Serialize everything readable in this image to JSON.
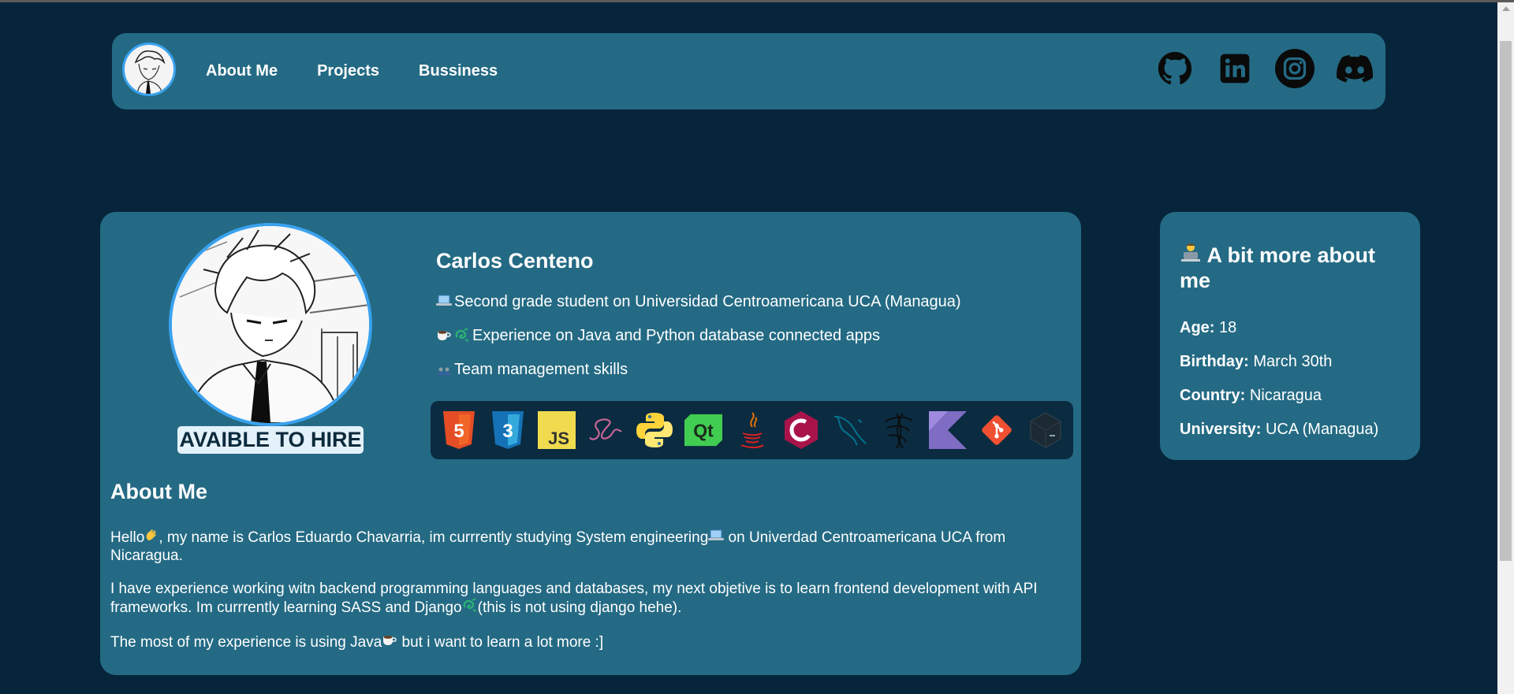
{
  "nav": {
    "links": [
      "About Me",
      "Projects",
      "Bussiness"
    ],
    "socials": [
      "github-icon",
      "linkedin-icon",
      "instagram-icon",
      "discord-icon"
    ]
  },
  "profile": {
    "name": "Carlos Centeno",
    "badge": "AVAIBLE TO HIRE",
    "lines": [
      {
        "icons": [
          "laptop-icon"
        ],
        "text": "Second grade student on Universidad Centroamericana UCA (Managua)"
      },
      {
        "icons": [
          "coffee-icon",
          "django-icon"
        ],
        "text": "Experience on Java and Python database connected apps"
      },
      {
        "icons": [
          "people-icon"
        ],
        "text": "Team management skills"
      }
    ],
    "tech": [
      "html5-icon",
      "css3-icon",
      "javascript-icon",
      "sass-icon",
      "python-icon",
      "qt-icon",
      "java-icon",
      "c-icon",
      "mysql-icon",
      "mssql-icon",
      "kotlin-icon",
      "git-icon",
      "terminal-icon"
    ]
  },
  "about": {
    "title": "About Me",
    "p1a": "Hello",
    "p1b": ", my name is Carlos Eduardo Chavarria, im currrently studying System engineering",
    "p1c": " on Univerdad Centroamericana UCA from Nicaragua.",
    "p2a": "I have experience working witn backend programming languages and databases, my next objetive is to learn frontend development with API frameworks. Im currrently learning SASS and Django",
    "p2b": "(this is not using django hehe).",
    "p3a": "The most of my experience is using Java",
    "p3b": " but i want to learn a lot more :]"
  },
  "side": {
    "title": "A bit more about me",
    "age_label": "Age:",
    "age": "18",
    "birthday_label": "Birthday:",
    "birthday": "March 30th",
    "country_label": "Country:",
    "country": "Nicaragua",
    "university_label": "University:",
    "university": "UCA (Managua)"
  },
  "colors": {
    "background": "#06253a",
    "card": "#246a84",
    "accent": "#3aa2ee",
    "strip": "#0b2b40"
  }
}
